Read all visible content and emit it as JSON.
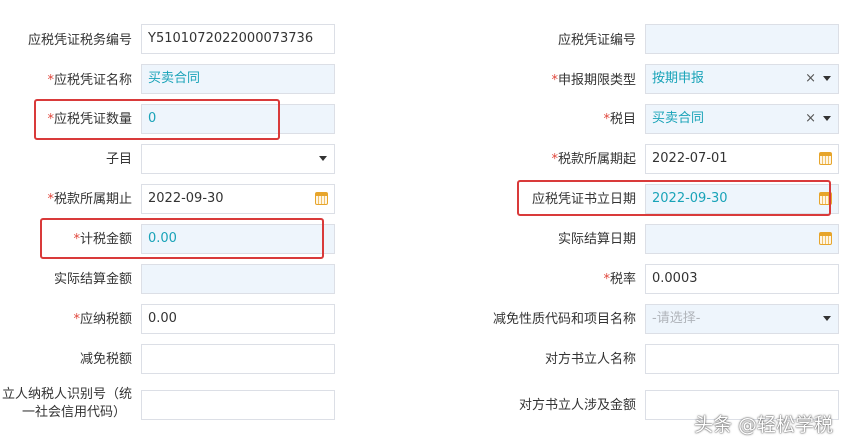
{
  "form": {
    "left": {
      "r1": {
        "label": "应税凭证税务编号",
        "value": "Y5101072022000073736"
      },
      "r2": {
        "label": "应税凭证名称",
        "value": "买卖合同"
      },
      "r3": {
        "label": "应税凭证数量",
        "value": "0"
      },
      "r4": {
        "label": "子目",
        "value": ""
      },
      "r5": {
        "label": "税款所属期止",
        "value": "2022-09-30"
      },
      "r6": {
        "label": "计税金额",
        "value": "0.00"
      },
      "r7": {
        "label": "实际结算金额",
        "value": ""
      },
      "r8": {
        "label": "应纳税额",
        "value": "0.00"
      },
      "r9": {
        "label": "减免税额",
        "value": ""
      },
      "r10": {
        "label_line1": "立人纳税人识别号（统",
        "label_line2": "一社会信用代码）",
        "value": ""
      }
    },
    "right": {
      "r1": {
        "label": "应税凭证编号",
        "value": ""
      },
      "r2": {
        "label": "申报期限类型",
        "value": "按期申报"
      },
      "r3": {
        "label": "税目",
        "value": "买卖合同"
      },
      "r4": {
        "label": "税款所属期起",
        "value": "2022-07-01"
      },
      "r5": {
        "label": "应税凭证书立日期",
        "value": "2022-09-30"
      },
      "r6": {
        "label": "实际结算日期",
        "value": ""
      },
      "r7": {
        "label": "税率",
        "value": "0.0003"
      },
      "r8": {
        "label": "减免性质代码和项目名称",
        "placeholder": "-请选择-"
      },
      "r9": {
        "label": "对方书立人名称",
        "value": ""
      },
      "r10": {
        "label": "对方书立人涉及金额",
        "value": ""
      }
    },
    "required_marker": "*",
    "clear_glyph": "×"
  },
  "watermark": "头条 @轻松学税",
  "colors": {
    "required": "#e0453a",
    "teal_value": "#19a3b8",
    "highlight": "#d93a3a",
    "readonly_bg": "#eef5fc"
  },
  "icons": {
    "dropdown": "chevron-down-icon",
    "calendar": "calendar-icon",
    "clear": "clear-icon"
  }
}
